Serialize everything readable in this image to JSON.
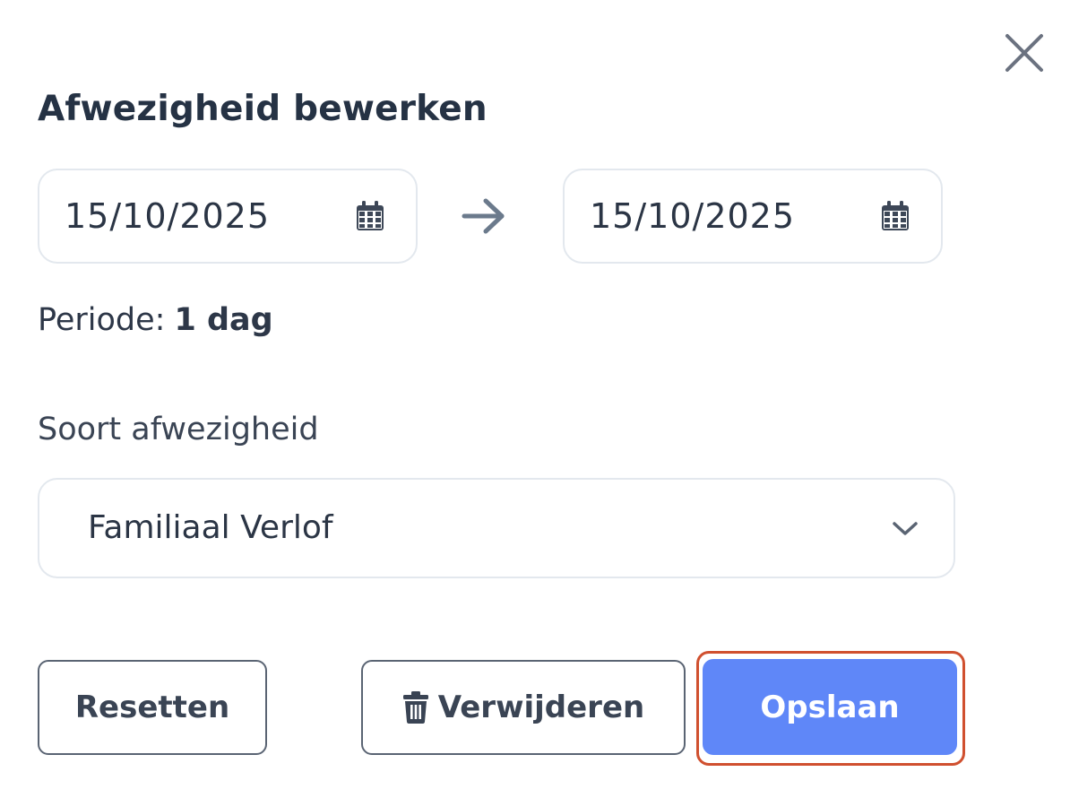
{
  "dialog": {
    "title": "Afwezigheid bewerken",
    "close_icon": "close-icon"
  },
  "dates": {
    "from": "15/10/2025",
    "to": "15/10/2025",
    "calendar_icon": "calendar-icon",
    "arrow_icon": "arrow-right-icon"
  },
  "period": {
    "label": "Periode:",
    "value": "1 dag"
  },
  "absence_type": {
    "label": "Soort afwezigheid",
    "selected": "Familiaal Verlof",
    "chevron_icon": "chevron-down-icon"
  },
  "buttons": {
    "reset_label": "Resetten",
    "delete_label": "Verwijderen",
    "delete_icon": "trash-icon",
    "save_label": "Opslaan"
  },
  "colors": {
    "primary": "#5f87f8",
    "highlight": "#d0502f",
    "text": "#253244",
    "border": "#e3e8ee"
  }
}
